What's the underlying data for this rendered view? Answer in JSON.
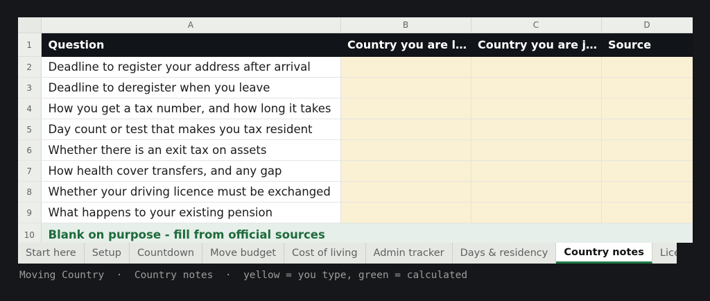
{
  "columns": [
    "A",
    "B",
    "C",
    "D"
  ],
  "row_numbers": [
    "1",
    "2",
    "3",
    "4",
    "5",
    "6",
    "7",
    "8",
    "9",
    "10"
  ],
  "header": {
    "question": "Question",
    "leaving": "Country you are le...",
    "joining": "Country you are jo...",
    "source": "Source"
  },
  "questions": [
    "Deadline to register your address after arrival",
    "Deadline to deregister when you leave",
    "How you get a tax number, and how long it takes",
    "Day count or test that makes you tax resident",
    "Whether there is an exit tax on assets",
    "How health cover transfers, and any gap",
    "Whether your driving licence must be exchanged",
    "What happens to your existing pension"
  ],
  "note": "Blank on purpose - fill from official sources",
  "tabs": [
    "Start here",
    "Setup",
    "Countdown",
    "Move budget",
    "Cost of living",
    "Admin tracker",
    "Days & residency",
    "Country notes",
    "Licence"
  ],
  "active_tab": "Country notes",
  "caption": {
    "app": "Moving Country",
    "sheet": "Country notes",
    "legend": "yellow = you type, green = calculated",
    "separator": "·"
  },
  "colors": {
    "input_fill": "#faf0d4",
    "calculated_fill": "#e6efe9",
    "header_fill": "#111418",
    "accent_green": "#1e6b3c"
  }
}
